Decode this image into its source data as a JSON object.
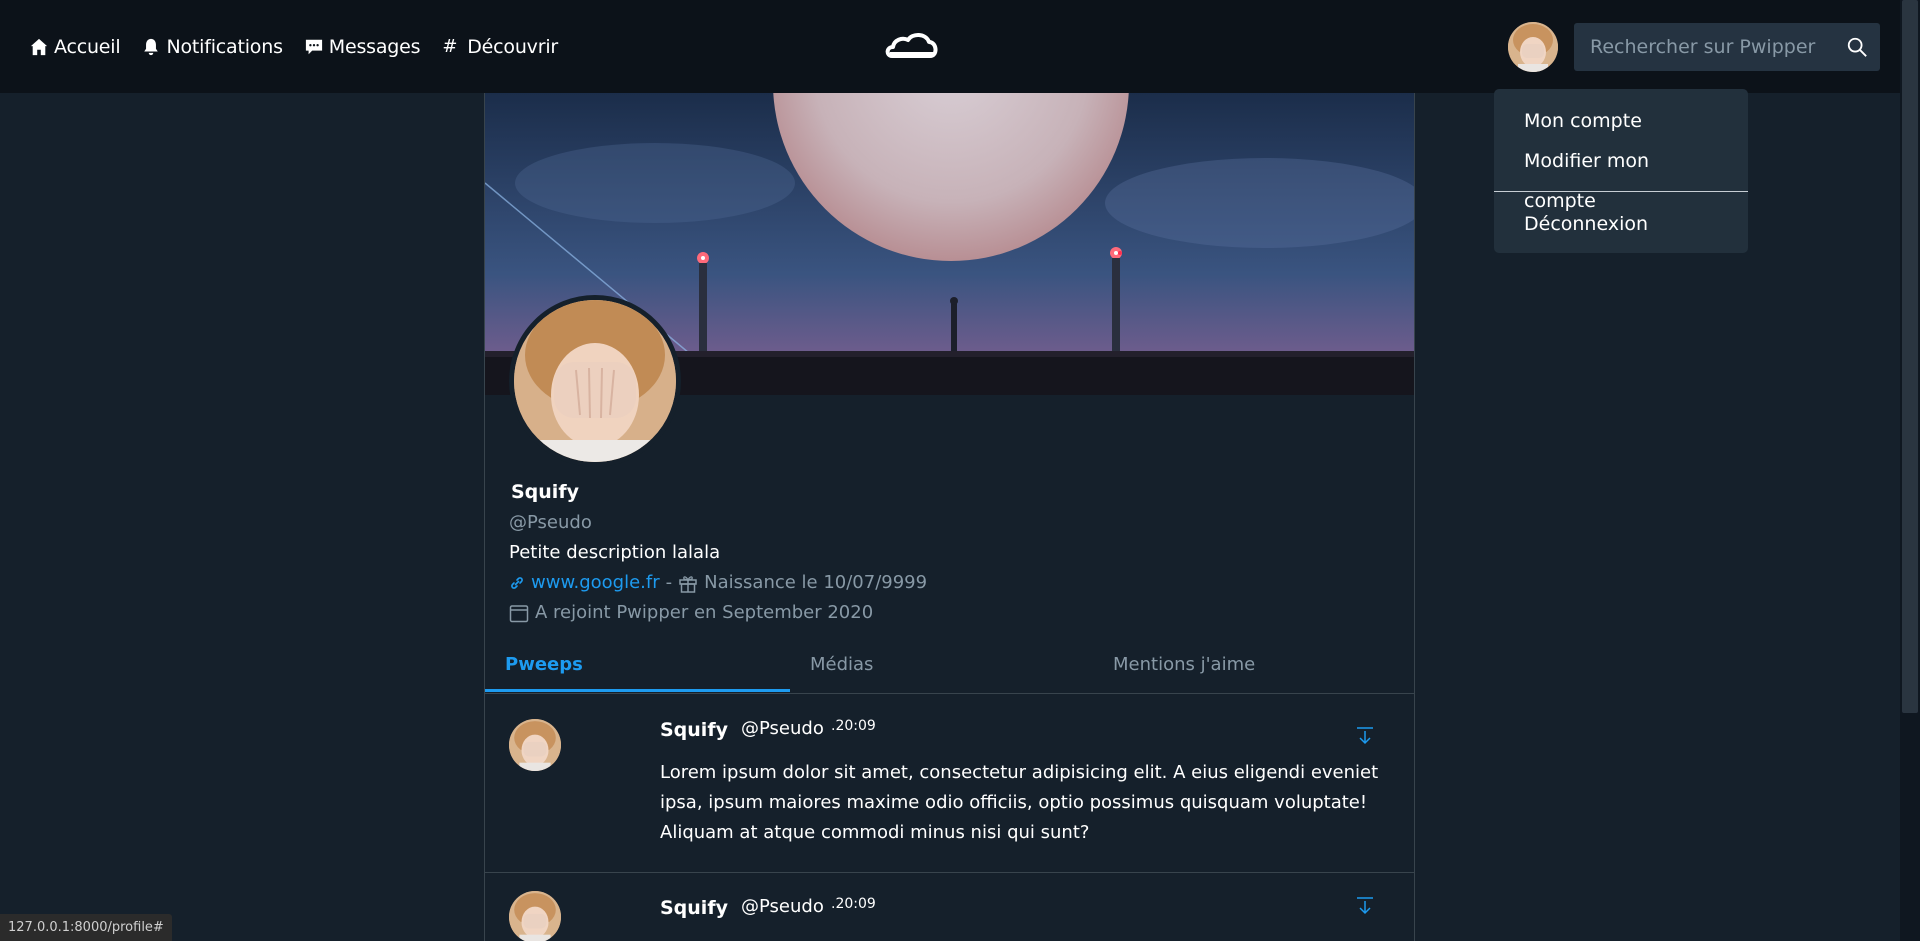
{
  "nav": {
    "home": "Accueil",
    "notifications": "Notifications",
    "messages": "Messages",
    "discover": "Découvrir"
  },
  "search": {
    "placeholder": "Rechercher sur Pwipper"
  },
  "account_menu": {
    "my_account": "Mon compte",
    "edit_account": "Modifier mon compte",
    "logout": "Déconnexion"
  },
  "profile": {
    "name": "Squify",
    "handle": "@Pseudo",
    "description": "Petite description lalala",
    "website": "www.google.fr",
    "separator": "-",
    "birthday": "Naissance le 10/07/9999",
    "joined": "A rejoint Pwipper en September 2020"
  },
  "tabs": [
    {
      "label": "Pweeps",
      "active": true
    },
    {
      "label": "Médias",
      "active": false
    },
    {
      "label": "Mentions j'aime",
      "active": false
    }
  ],
  "pweeps": [
    {
      "name": "Squify",
      "handle": "@Pseudo",
      "time": ".20:09",
      "body": "Lorem ipsum dolor sit amet, consectetur adipisicing elit. A eius eligendi eveniet ipsa, ipsum maiores maxime odio officiis, optio possimus quisquam voluptate! Aliquam at atque commodi minus nisi qui sunt?"
    },
    {
      "name": "Squify",
      "handle": "@Pseudo",
      "time": ".20:09",
      "body": ""
    }
  ],
  "status_bar": {
    "url": "127.0.0.1:8000/profile#"
  },
  "colors": {
    "background": "#15202b",
    "navbar": "#0c1219",
    "accent": "#1d9bf0",
    "muted_text": "#8899a6"
  },
  "icons": [
    "home-icon",
    "bell-icon",
    "message-icon",
    "hash-icon",
    "cloud-logo-icon",
    "search-icon",
    "link-icon",
    "gift-icon",
    "calendar-icon",
    "arrow-down-icon"
  ]
}
